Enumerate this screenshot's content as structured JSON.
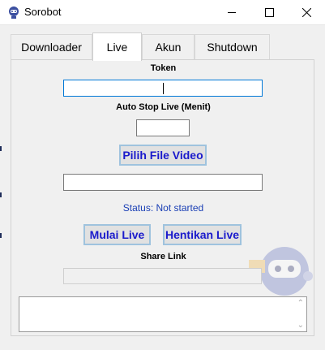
{
  "window": {
    "title": "Sorobot",
    "icon": "robot-app-icon",
    "controls": [
      "minimize-icon",
      "maximize-icon",
      "close-icon"
    ]
  },
  "tabs": [
    {
      "label": "Downloader",
      "active": false
    },
    {
      "label": "Live",
      "active": true
    },
    {
      "label": "Akun",
      "active": false
    },
    {
      "label": "Shutdown",
      "active": false
    }
  ],
  "live": {
    "token_label": "Token",
    "token_value": "",
    "auto_stop_label": "Auto Stop Live (Menit)",
    "auto_stop_value": "",
    "pick_video_button": "Pilih File Video",
    "video_path_value": "",
    "status_text": "Status: Not started",
    "start_button": "Mulai Live",
    "stop_button": "Hentikan Live",
    "share_link_label": "Share Link",
    "share_link_value": "",
    "log_text": ""
  },
  "colors": {
    "accent_text": "#1a1acc",
    "status_text": "#1a3fb5",
    "button_border": "#9fc3de",
    "focus_border": "#0078d7"
  }
}
